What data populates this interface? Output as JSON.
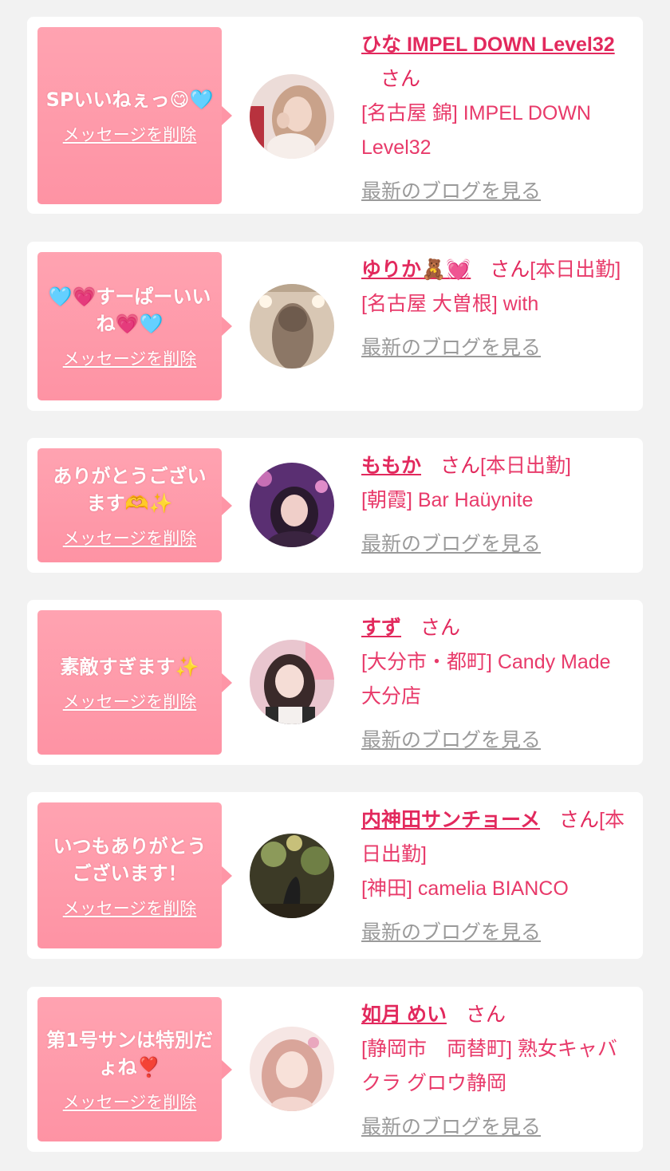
{
  "cards": [
    {
      "message": "SPいいねぇっ😋🩵",
      "delete_label": "メッセージを削除",
      "name": "ひな IMPEL DOWN Level32",
      "honorific": "さん",
      "status": "",
      "shop": "[名古屋 錦] IMPEL DOWN Level32",
      "blog_label": "最新のブログを見る"
    },
    {
      "message": "🩵💗すーぱーいいね💗🩵",
      "delete_label": "メッセージを削除",
      "name": "ゆりか🧸💓",
      "honorific": "さん",
      "status": "[本日出勤]",
      "shop": "[名古屋 大曽根] with",
      "blog_label": "最新のブログを見る"
    },
    {
      "message": "ありがとうございます🫶✨",
      "delete_label": "メッセージを削除",
      "name": "ももか",
      "honorific": "さん",
      "status": "[本日出勤]",
      "shop": "[朝霞] Bar Haüynite",
      "blog_label": "最新のブログを見る"
    },
    {
      "message": "素敵すぎます✨",
      "delete_label": "メッセージを削除",
      "name": "すず",
      "honorific": "さん",
      "status": "",
      "shop": "[大分市・都町] Candy Made 大分店",
      "blog_label": "最新のブログを見る"
    },
    {
      "message": "いつもありがとうございます！",
      "delete_label": "メッセージを削除",
      "name": "内神田サンチョーメ",
      "honorific": "さん",
      "status": "[本日出勤]",
      "shop": "[神田] camelia BIANCO",
      "blog_label": "最新のブログを見る"
    },
    {
      "message": "第1号サンは特別だょね❣️",
      "delete_label": "メッセージを削除",
      "name": "如月 めい",
      "honorific": "さん",
      "status": "",
      "shop": "[静岡市　両替町] 熟女キャバクラ グロウ静岡",
      "blog_label": "最新のブログを見る"
    }
  ]
}
